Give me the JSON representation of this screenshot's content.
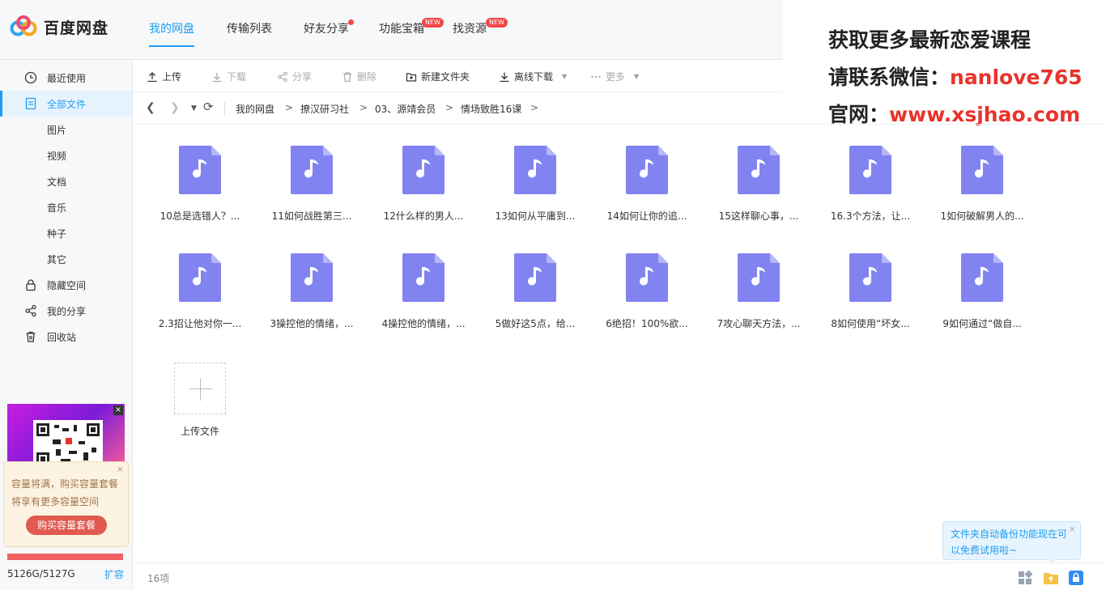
{
  "app": {
    "name": "百度网盘"
  },
  "nav": {
    "tabs": [
      {
        "label": "我的网盘"
      },
      {
        "label": "传输列表"
      },
      {
        "label": "好友分享"
      },
      {
        "label": "功能宝箱",
        "badge": "NEW"
      },
      {
        "label": "找资源",
        "badge": "NEW"
      }
    ]
  },
  "watermark": {
    "line1": "获取更多最新恋爱课程",
    "line2_prefix": "请联系微信：",
    "line2_value": "nanlove765",
    "line3_prefix": "官网：",
    "line3_value": "www.xsjhao.com"
  },
  "sidebar": {
    "items": [
      {
        "label": "最近使用",
        "icon": "clock-icon"
      },
      {
        "label": "全部文件",
        "icon": "file-list-icon",
        "active": true
      },
      {
        "label": "图片"
      },
      {
        "label": "视频"
      },
      {
        "label": "文档"
      },
      {
        "label": "音乐"
      },
      {
        "label": "种子"
      },
      {
        "label": "其它"
      },
      {
        "label": "隐藏空间",
        "icon": "lock-icon"
      },
      {
        "label": "我的分享",
        "icon": "share-icon"
      },
      {
        "label": "回收站",
        "icon": "trash-icon"
      }
    ],
    "promo": {
      "text": "容量将满，购买容量套餐将享有更多容量空间",
      "button": "购买容量套餐",
      "close": "×"
    },
    "quota": {
      "text": "5126G/5127G",
      "used_fraction": 0.9998,
      "expand": "扩容"
    }
  },
  "toolbar": {
    "upload": "上传",
    "download": "下载",
    "share": "分享",
    "delete": "删除",
    "new_folder": "新建文件夹",
    "offline_download": "离线下载",
    "more": "更多"
  },
  "breadcrumb": {
    "items": [
      "我的网盘",
      "撩汉研习社",
      "03、源靖会员",
      "情场致胜16课"
    ],
    "separator": ">"
  },
  "files": [
    "10总是选错人？...",
    "11如何战胜第三...",
    "12什么样的男人...",
    "13如何从平庸到...",
    "14如何让你的追...",
    "15这样聊心事，...",
    "16.3个方法，让...",
    "1如何破解男人的...",
    "2.3招让他对你一...",
    "3操控他的情绪，...",
    "4操控他的情绪，...",
    "5做好这5点，给...",
    "6绝招！100%欲...",
    "7攻心聊天方法，...",
    "8如何使用“坏女...",
    "9如何通过“做自..."
  ],
  "upload_tile": {
    "label": "上传文件"
  },
  "status": {
    "count": "16项"
  },
  "tip": {
    "text": "文件夹自动备份功能现在可以免费试用啦~",
    "close": "×"
  },
  "colors": {
    "accent": "#1e9ef0",
    "file_icon": "#8184f0",
    "warning": "#e05a4f"
  }
}
